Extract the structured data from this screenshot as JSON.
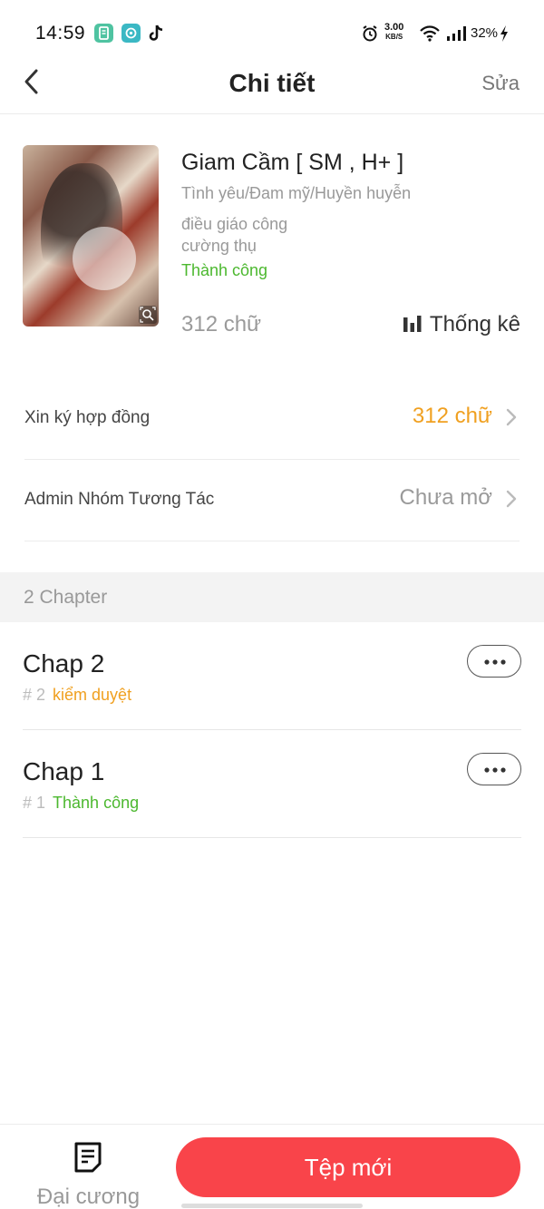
{
  "status_bar": {
    "time": "14:59",
    "net_speed": "3.00",
    "net_speed_unit": "KB/S",
    "battery": "32%",
    "icons": [
      "app-green-icon",
      "app-teal-icon",
      "tiktok-icon",
      "alarm-icon",
      "wifi-icon",
      "signal-icon",
      "charging-icon"
    ]
  },
  "header": {
    "title": "Chi tiết",
    "edit_label": "Sửa",
    "back_icon": "chevron-left-icon"
  },
  "book": {
    "title": "Giam Cầm [ SM , H+ ]",
    "genre": "Tình yêu/Đam mỹ/Huyền huyễn",
    "tags_line1": "điều giáo công",
    "tags_line2": "cường thụ",
    "status": "Thành công",
    "word_count": "312 chữ",
    "stats_label": "Thống kê",
    "status_color": "#4cb82f"
  },
  "rows": [
    {
      "label": "Xin ký hợp đồng",
      "value": "312 chữ",
      "color": "#f0a020"
    },
    {
      "label": "Admin Nhóm Tương Tác",
      "value": "Chưa mở",
      "color": "#9a9a9a"
    }
  ],
  "chapters_section": {
    "header": "2 Chapter",
    "items": [
      {
        "title": "Chap 2",
        "number": "# 2",
        "status": "kiểm duyệt",
        "status_color": "#f0a020"
      },
      {
        "title": "Chap 1",
        "number": "# 1",
        "status": "Thành công",
        "status_color": "#4cb82f"
      }
    ]
  },
  "bottom_bar": {
    "outline_label": "Đại cương",
    "new_label": "Tệp mới",
    "accent": "#f9444a"
  }
}
